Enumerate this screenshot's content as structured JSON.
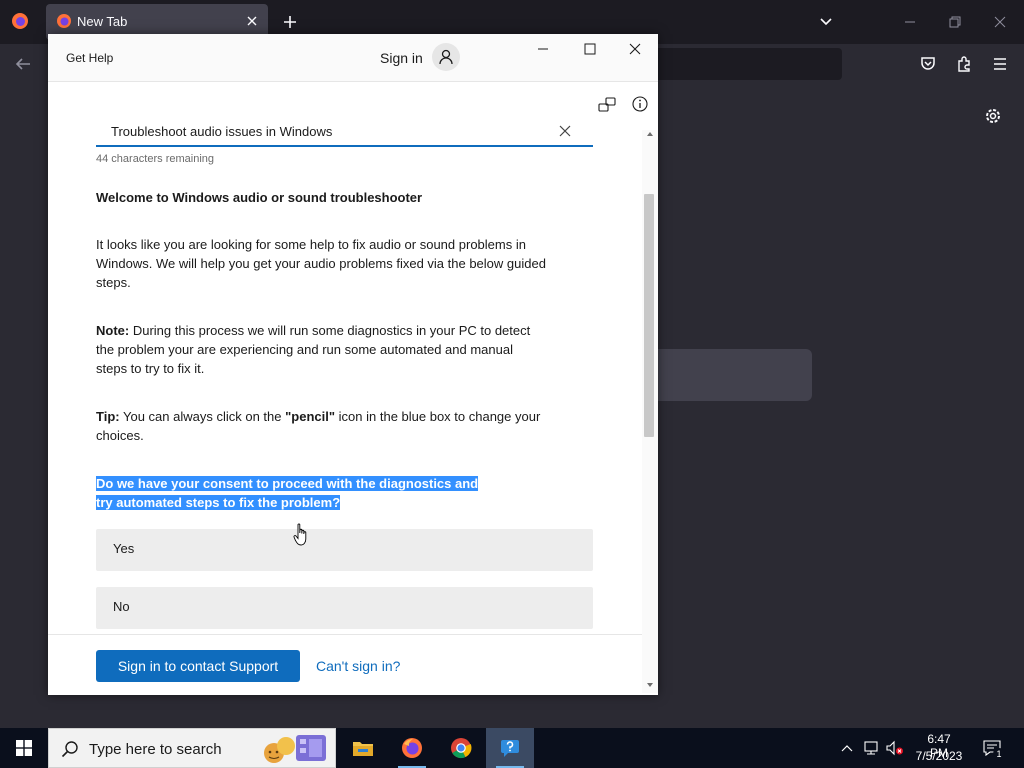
{
  "browser": {
    "tab_title": "New Tab"
  },
  "help_window": {
    "title": "Get Help",
    "sign_in_label": "Sign in",
    "search_value": "Troubleshoot audio issues in Windows",
    "chars_remaining": "44 characters remaining",
    "welcome_heading": "Welcome to Windows audio or sound troubleshooter",
    "intro_text": "It looks like you are looking for some help to fix audio or sound problems in Windows. We will help you get your audio problems fixed via the below guided steps.",
    "note_label": "Note:",
    "note_text": "During this process we will run some diagnostics in your PC to detect the problem your are experiencing and run some automated  and manual steps to try to fix it.",
    "tip_label": "Tip:",
    "tip_text_before": "You can always click on the",
    "tip_pencil": "\"pencil\"",
    "tip_text_after": "icon in the blue box to change your choices.",
    "consent_question": "Do we have your consent to proceed with the diagnostics and try automated steps to fix the problem?",
    "choices": [
      "Yes",
      "No"
    ],
    "contact_button": "Sign in to contact Support",
    "cant_sign_in": "Can't sign in?",
    "scroll_position": 0.18
  },
  "taskbar": {
    "search_placeholder": "Type here to search",
    "pinned_apps": [
      "file-explorer",
      "firefox",
      "chrome",
      "get-help"
    ],
    "clock_time": "6:47 PM",
    "clock_date": "7/5/2023",
    "notification_count": "1"
  },
  "colors": {
    "accent": "#0f6cbd",
    "selection": "#3390ff",
    "firefox_dark": "#1c1b22"
  }
}
